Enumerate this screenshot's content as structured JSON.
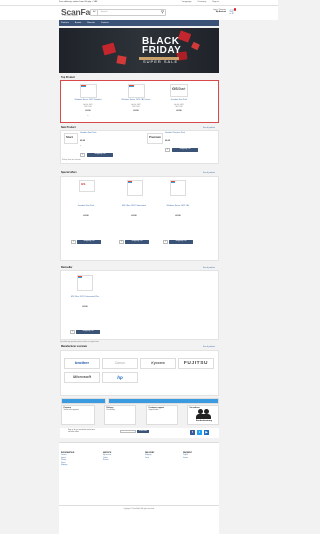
{
  "topbar": {
    "promo": "Free delivery, orders from 60 gbp + VAT",
    "links": [
      "Language",
      "Currency",
      "Sign in"
    ]
  },
  "header": {
    "logo": "ScanFabrik",
    "logo_sub": "IT and Office Supplies",
    "search_cat": "All",
    "search_placeholder": "Search",
    "account_line": "Log in / Register",
    "account_sub": "My Account",
    "cart_count": "0"
  },
  "nav": [
    "Products",
    "Brands",
    "Manuals",
    "Contacts"
  ],
  "banner": {
    "line1": "BLACK",
    "line2": "FRIDAY",
    "tag": "SUPER SALE"
  },
  "sections": {
    "top": "Top Product",
    "new": "New Product",
    "special": "Special offers",
    "bestseller": "Bestseller",
    "manufacturers": "Manufacturer overview",
    "see_all": "See all products"
  },
  "top_products": [
    {
      "name": "Windows Server 2022 Standard",
      "meta1": "Art.-Nr.: 0001",
      "meta2": "SKU: 1000",
      "price": "£0.00"
    },
    {
      "name": "Windows Server 2022 CAL Device",
      "meta1": "Art.-Nr.: 0002",
      "meta2": "SKU: 1001",
      "price": "£0.00"
    },
    {
      "name": "Geodata Start Pack",
      "meta1": "Art.-Nr.: 0003",
      "meta2": "SKU: 1002",
      "price": "£0.00"
    }
  ],
  "new_products": [
    {
      "name": "Geodata Start Pack",
      "price": "£0.00",
      "btn": "Shopping cart"
    },
    {
      "name": "Geodata Premium Pack",
      "price": "£0.00",
      "btn": "Shopping cart"
    }
  ],
  "new_note": "Delivery times are estimates",
  "special_products": [
    {
      "name": "Geodata Start Pack",
      "price": "£0.00",
      "btn": "Shopping cart"
    },
    {
      "name": "MS Office 2021 Professional",
      "price": "£0.00",
      "btn": "Shopping cart"
    },
    {
      "name": "Windows Server 2022 CAL",
      "price": "£0.00",
      "btn": "Shopping cart"
    }
  ],
  "bestseller_products": [
    {
      "name": "MS Office 2021 Professional Plus",
      "price": "£0.00",
      "btn": "Shopping cart"
    }
  ],
  "bestseller_note": "If you have any questions please contact our support team",
  "manufacturers": [
    "brother",
    "Canon",
    "Kyocera",
    "FUJITSU",
    "Microsoft",
    "hp"
  ],
  "info_boxes": [
    {
      "title": "Payment",
      "text": "Secure online payment"
    },
    {
      "title": "Delivery",
      "text": "Fast delivery"
    },
    {
      "title": "Customer support",
      "text": "Support hotline"
    },
    {
      "title": "Our advisor",
      "text": "Customer service"
    }
  ],
  "advisor_name": "Kundenberatung",
  "newsletter": {
    "text": "Sign up for our newsletter and receive exclusive offers",
    "btn": "Subscribe"
  },
  "footer": {
    "cols": [
      {
        "title": "INFORMATION",
        "items": [
          "Contact",
          "Imprint",
          "Privacy",
          "Terms",
          "Shipping"
        ]
      },
      {
        "title": "SERVICE",
        "items": [
          "My account",
          "Orders",
          "Returns"
        ]
      },
      {
        "title": "DELIVERY",
        "items": [
          "Shipping",
          "Costs"
        ]
      },
      {
        "title": "PAYMENT",
        "items": [
          "PayPal",
          "Invoice"
        ]
      }
    ],
    "copyright": "Copyright © ScanFabrik. All rights reserved."
  }
}
